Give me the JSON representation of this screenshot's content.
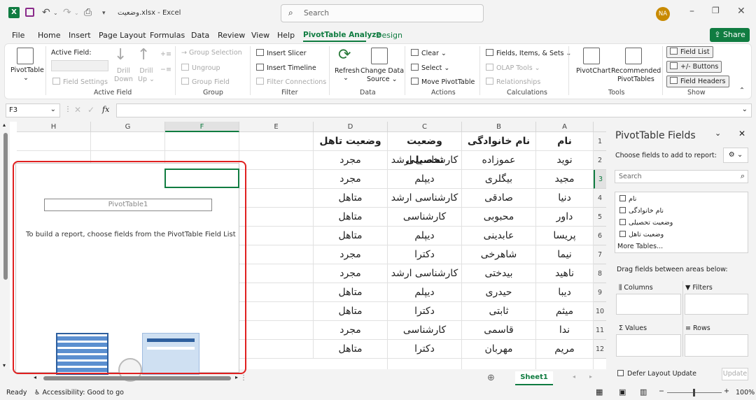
{
  "titlebar": {
    "file_title": "وضعیت.xlsx  -  Excel",
    "search_placeholder": "Search",
    "user_initials": "NA"
  },
  "menu": {
    "items": [
      "File",
      "Home",
      "Insert",
      "Page Layout",
      "Formulas",
      "Data",
      "Review",
      "View",
      "Help",
      "PivotTable Analyze",
      "Design"
    ],
    "active": "PivotTable Analyze",
    "share_label": "Share"
  },
  "ribbon": {
    "pivottable": {
      "label": "PivotTable"
    },
    "active_field": {
      "label": "Active Field:",
      "field_settings": "Field Settings",
      "drill_down": "Drill\nDown",
      "drill_up": "Drill\nUp",
      "group_label": "Active Field"
    },
    "group": {
      "selection": "Group Selection",
      "ungroup": "Ungroup",
      "field": "Group Field",
      "group_label": "Group"
    },
    "filter": {
      "slicer": "Insert Slicer",
      "timeline": "Insert Timeline",
      "connections": "Filter Connections",
      "group_label": "Filter"
    },
    "data": {
      "refresh": "Refresh",
      "change_source_1": "Change Data",
      "change_source_2": "Source",
      "group_label": "Data"
    },
    "actions": {
      "clear": "Clear",
      "select": "Select",
      "move": "Move PivotTable",
      "group_label": "Actions"
    },
    "calculations": {
      "fields": "Fields, Items, & Sets",
      "olap": "OLAP Tools",
      "relationships": "Relationships",
      "group_label": "Calculations"
    },
    "tools": {
      "pivotchart": "PivotChart",
      "recommended_1": "Recommended",
      "recommended_2": "PivotTables",
      "group_label": "Tools"
    },
    "show": {
      "field_list": "Field List",
      "buttons": "+/- Buttons",
      "headers": "Field Headers",
      "group_label": "Show"
    }
  },
  "formula": {
    "name_box": "F3",
    "fx": "fx"
  },
  "grid": {
    "columns": [
      "H",
      "G",
      "F",
      "E",
      "D",
      "C",
      "B",
      "A"
    ],
    "rows": [
      "1",
      "2",
      "3",
      "4",
      "5",
      "6",
      "7",
      "8",
      "9",
      "10",
      "11",
      "12"
    ],
    "headers": {
      "A": "نام",
      "B": "نام خانوادگی",
      "C": "وضعیت تحصیلی",
      "D": "وضعیت تاهل"
    },
    "data": [
      [
        "نوید",
        "عموزاده",
        "کارشناسی ارشد",
        "مجرد"
      ],
      [
        "مجید",
        "بیگلری",
        "دیپلم",
        "مجرد"
      ],
      [
        "دنیا",
        "صادقی",
        "کارشناسی ارشد",
        "متاهل"
      ],
      [
        "داور",
        "محبوبی",
        "کارشناسی",
        "متاهل"
      ],
      [
        "پریسا",
        "عابدینی",
        "دیپلم",
        "متاهل"
      ],
      [
        "نیما",
        "شاهرخی",
        "دکترا",
        "مجرد"
      ],
      [
        "ناهید",
        "بیدختی",
        "کارشناسی ارشد",
        "مجرد"
      ],
      [
        "دیبا",
        "حیدری",
        "دیپلم",
        "متاهل"
      ],
      [
        "میثم",
        "ثابتی",
        "دکترا",
        "متاهل"
      ],
      [
        "ندا",
        "قاسمی",
        "کارشناسی",
        "مجرد"
      ],
      [
        "مریم",
        "مهربان",
        "دکترا",
        "متاهل"
      ]
    ]
  },
  "pivot": {
    "name": "PivotTable1",
    "instruction": "To build a report, choose fields from the PivotTable Field List"
  },
  "sheet": {
    "tab": "Sheet1"
  },
  "pane": {
    "title": "PivotTable Fields",
    "choose_label": "Choose fields to add to report:",
    "search_placeholder": "Search",
    "fields": [
      "نام",
      "نام خانوادگی",
      "وضعیت تحصیلی",
      "وضعیت تاهل"
    ],
    "more_tables": "More Tables...",
    "drag_label": "Drag fields between areas below:",
    "areas": {
      "filters": "Filters",
      "columns": "Columns",
      "rows": "Rows",
      "values": "Values"
    },
    "defer": "Defer Layout Update",
    "update": "Update"
  },
  "status": {
    "ready": "Ready",
    "accessibility": "Accessibility: Good to go",
    "zoom": "100%"
  }
}
